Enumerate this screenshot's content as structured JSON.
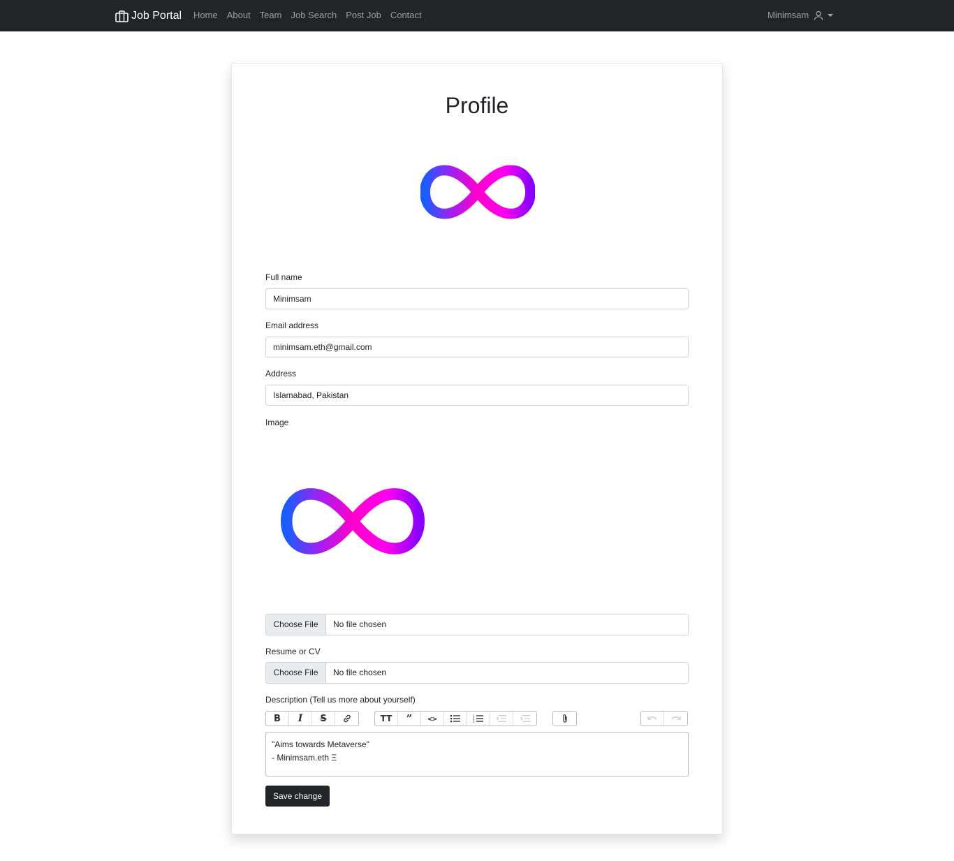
{
  "nav": {
    "brand": "Job Portal",
    "links": [
      "Home",
      "About",
      "Team",
      "Job Search",
      "Post Job",
      "Contact"
    ],
    "user": "Minimsam"
  },
  "profile": {
    "title": "Profile",
    "full_name_label": "Full name",
    "full_name": "Minimsam",
    "email_label": "Email address",
    "email": "minimsam.eth@gmail.com",
    "address_label": "Address",
    "address": "Islamabad, Pakistan",
    "image_label": "Image",
    "image_file_button": "Choose File",
    "image_file_name": "No file chosen",
    "resume_label": "Resume or CV",
    "resume_file_button": "Choose File",
    "resume_file_name": "No file chosen",
    "description_label": "Description (Tell us more about yourself)",
    "description_line1": "\"Aims towards Metaverse\"",
    "description_line2": "- Minimsam.eth Ξ",
    "save_label": "Save change"
  },
  "colors": {
    "navbar": "#212529",
    "logo_start": "#1a5cff",
    "logo_mid": "#ff00cc",
    "logo_end": "#8a00ff"
  },
  "icons": [
    "briefcase-icon",
    "user-icon",
    "bold-icon",
    "italic-icon",
    "strike-icon",
    "link-icon",
    "heading-icon",
    "quote-icon",
    "code-icon",
    "bullet-list-icon",
    "number-list-icon",
    "outdent-icon",
    "indent-icon",
    "attach-icon",
    "undo-icon",
    "redo-icon"
  ]
}
